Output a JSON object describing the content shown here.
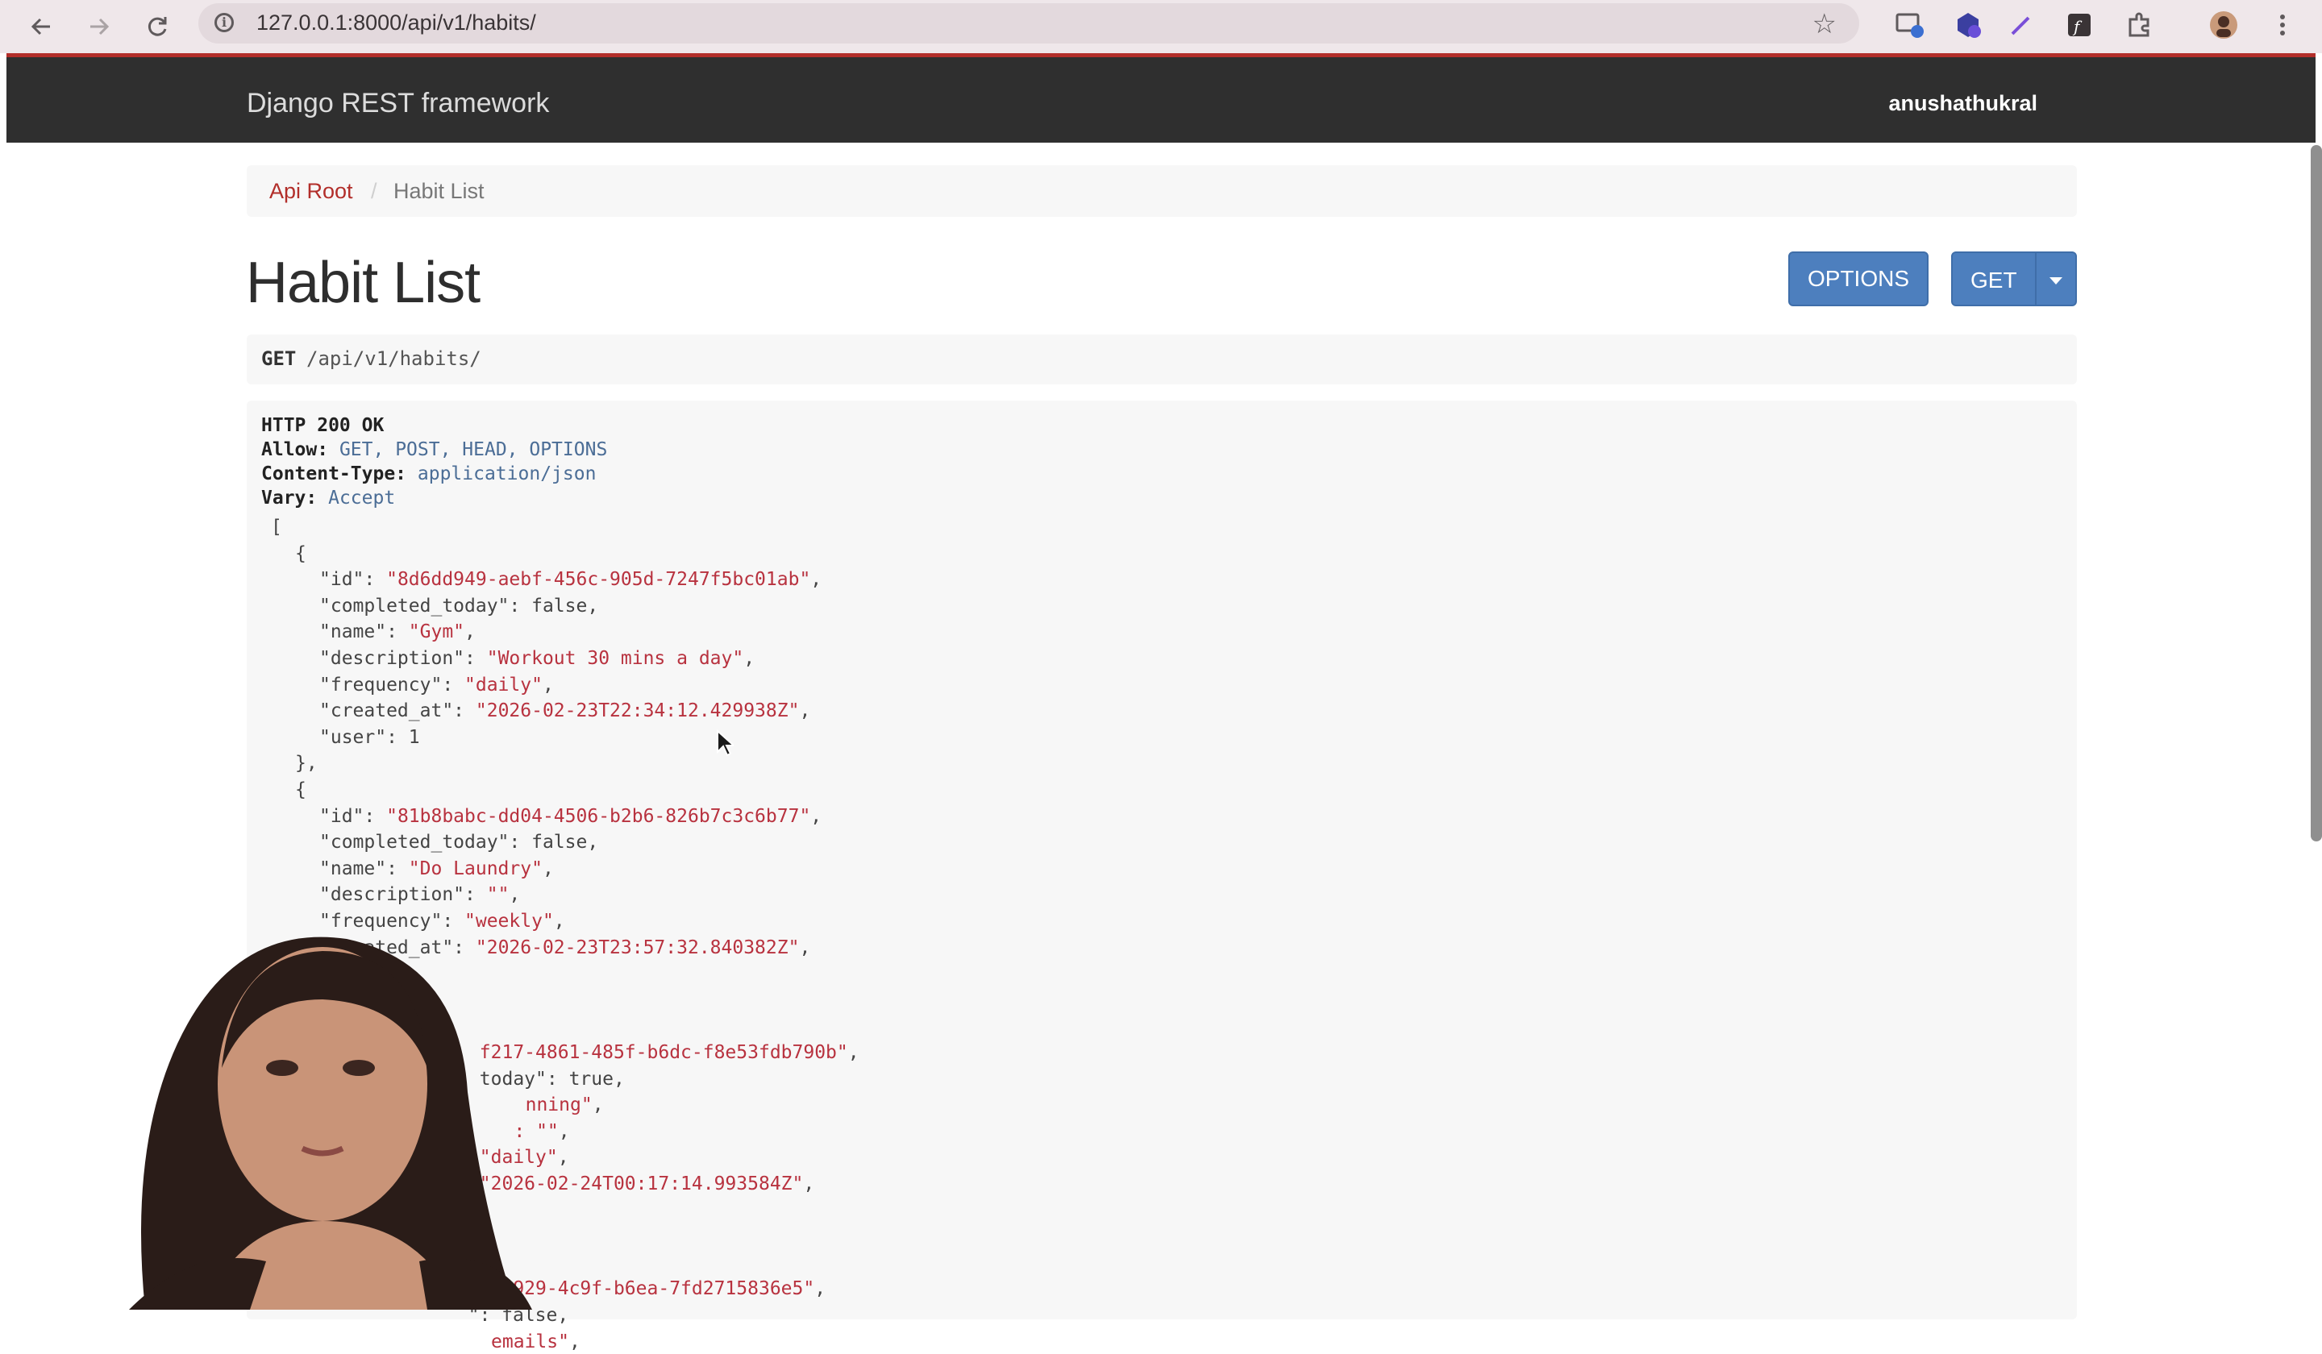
{
  "browser": {
    "url": "127.0.0.1:8000/api/v1/habits/",
    "icons": [
      "back-arrow-icon",
      "forward-arrow-icon",
      "reload-icon",
      "site-info-icon",
      "bookmark-star-icon",
      "cast-icon",
      "extension-puzzle-icon",
      "profile-avatar-icon",
      "menu-dots-icon"
    ]
  },
  "navbar": {
    "brand": "Django REST framework",
    "username": "anushathukral"
  },
  "breadcrumb": {
    "root": "Api Root",
    "separator": "/",
    "current": "Habit List"
  },
  "page": {
    "title": "Habit List",
    "options_label": "OPTIONS",
    "get_label": "GET"
  },
  "request": {
    "method": "GET",
    "path": "/api/v1/habits/"
  },
  "response": {
    "status": "HTTP 200 OK",
    "headers": [
      {
        "key": "Allow:",
        "value": "GET, POST, HEAD, OPTIONS"
      },
      {
        "key": "Content-Type:",
        "value": "application/json"
      },
      {
        "key": "Vary:",
        "value": "Accept"
      }
    ],
    "lines": [
      {
        "indent": 0,
        "text": "["
      },
      {
        "indent": 1,
        "text": "{"
      },
      {
        "indent": 2,
        "key": "\"id\": ",
        "val": "\"8d6dd949-aebf-456c-905d-7247f5bc01ab\"",
        "tail": ","
      },
      {
        "indent": 2,
        "key": "\"completed_today\": ",
        "kw": "false",
        "tail": ","
      },
      {
        "indent": 2,
        "key": "\"name\": ",
        "val": "\"Gym\"",
        "tail": ","
      },
      {
        "indent": 2,
        "key": "\"description\": ",
        "val": "\"Workout 30 mins a day\"",
        "tail": ","
      },
      {
        "indent": 2,
        "key": "\"frequency\": ",
        "val": "\"daily\"",
        "tail": ","
      },
      {
        "indent": 2,
        "key": "\"created_at\": ",
        "val": "\"2026-02-23T22:34:12.429938Z\"",
        "tail": ","
      },
      {
        "indent": 2,
        "key": "\"user\": ",
        "kw": "1",
        "tail": ""
      },
      {
        "indent": 1,
        "text": "},"
      },
      {
        "indent": 1,
        "text": "{"
      },
      {
        "indent": 2,
        "key": "\"id\": ",
        "val": "\"81b8babc-dd04-4506-b2b6-826b7c3c6b77\"",
        "tail": ","
      },
      {
        "indent": 2,
        "key": "\"completed_today\": ",
        "kw": "false",
        "tail": ","
      },
      {
        "indent": 2,
        "key": "\"name\": ",
        "val": "\"Do Laundry\"",
        "tail": ","
      },
      {
        "indent": 2,
        "key": "\"description\": ",
        "val": "\"\"",
        "tail": ","
      },
      {
        "indent": 2,
        "key": "\"frequency\": ",
        "val": "\"weekly\"",
        "tail": ","
      },
      {
        "indent": 2,
        "key": "\"created_at\": ",
        "val": "\"2026-02-23T23:57:32.840382Z\"",
        "tail": ","
      },
      {
        "indent": 2,
        "text": ""
      },
      {
        "indent": 1,
        "text": ""
      },
      {
        "indent": 1,
        "text": ""
      },
      {
        "indent": 2,
        "key": "",
        "val": "f217-4861-485f-b6dc-f8e53fdb790b\"",
        "tail": ",",
        "pad": 14
      },
      {
        "indent": 2,
        "key": "",
        "kw": "today\": true",
        "tail": ",",
        "pad": 14
      },
      {
        "indent": 2,
        "key": "",
        "val": "nning\"",
        "tail": ",",
        "pad": 18
      },
      {
        "indent": 2,
        "key": "",
        "val": ": \"\"",
        "tail": ",",
        "pad": 17
      },
      {
        "indent": 2,
        "key": "",
        "val": "\"daily\"",
        "tail": ",",
        "pad": 14
      },
      {
        "indent": 2,
        "key": "",
        "val": "\"2026-02-24T00:17:14.993584Z\"",
        "tail": ",",
        "pad": 14
      },
      {
        "indent": 2,
        "text": ""
      },
      {
        "indent": 1,
        "text": ""
      },
      {
        "indent": 1,
        "text": ""
      },
      {
        "indent": 2,
        "key": "",
        "val": "8-2929-4c9f-b6ea-7fd2715836e5\"",
        "tail": ",",
        "pad": 14
      },
      {
        "indent": 2,
        "key": "",
        "kw": "\": false",
        "tail": ",",
        "pad": 13
      },
      {
        "indent": 2,
        "key": "",
        "val": "emails\"",
        "tail": ",",
        "pad": 15
      }
    ]
  },
  "colors": {
    "navbar_bg": "#2f2f2f",
    "accent_red": "#b22e2a",
    "button_blue": "#4d7fbe",
    "json_string": "#b8323f",
    "header_value": "#4b6d96"
  }
}
